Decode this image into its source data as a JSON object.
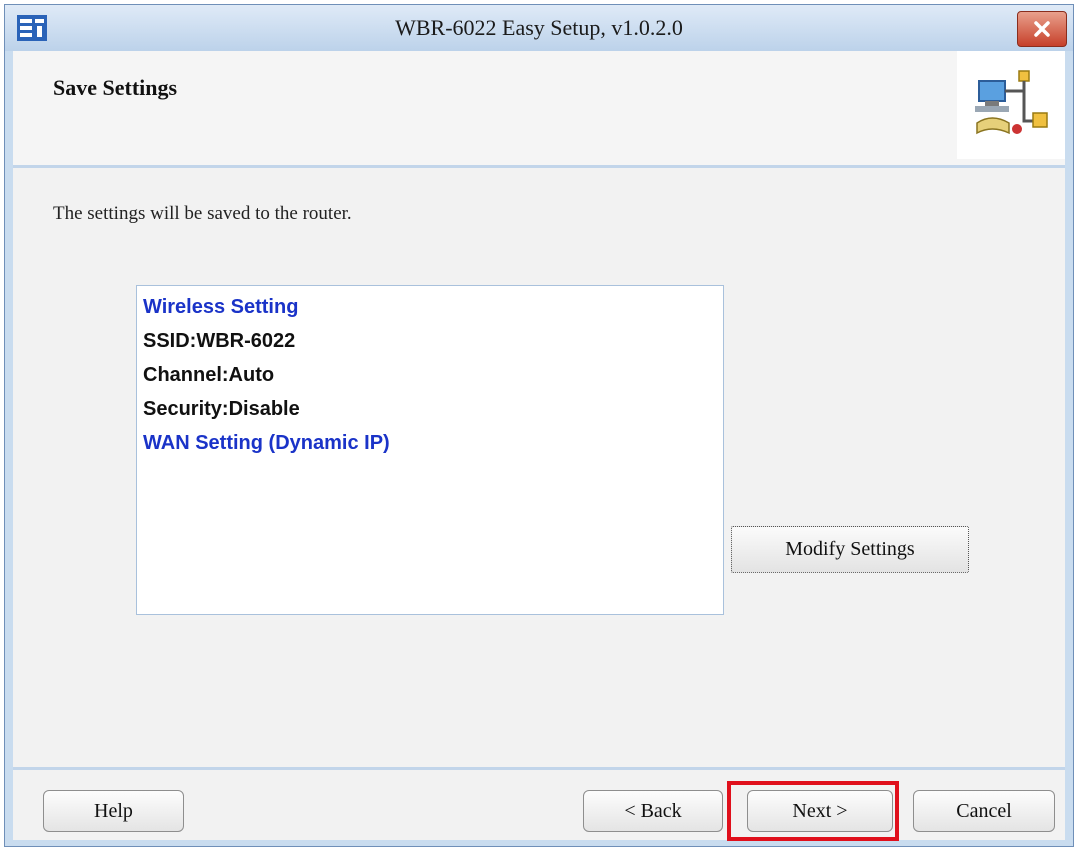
{
  "window": {
    "title": "WBR-6022 Easy Setup, v1.0.2.0"
  },
  "page": {
    "heading": "Save Settings",
    "description": "The settings will be saved to the router."
  },
  "summary": {
    "lines": [
      {
        "text": "Wireless Setting",
        "color": "#1a33c8"
      },
      {
        "text": "SSID:WBR-6022",
        "color": "#111111"
      },
      {
        "text": "Channel:Auto",
        "color": "#111111"
      },
      {
        "text": "Security:Disable",
        "color": "#111111"
      },
      {
        "text": "WAN Setting  (Dynamic IP)",
        "color": "#1a33c8"
      }
    ]
  },
  "buttons": {
    "modify": "Modify Settings",
    "help": "Help",
    "back": "< Back",
    "next": "Next >",
    "cancel": "Cancel"
  },
  "colors": {
    "titlebar": "#bcd2ea",
    "close_button": "#c6402a",
    "highlight": "#e0101c",
    "accent_text": "#1a33c8"
  },
  "icons": [
    "app-logo-icon",
    "close-icon",
    "network-setup-icon"
  ]
}
